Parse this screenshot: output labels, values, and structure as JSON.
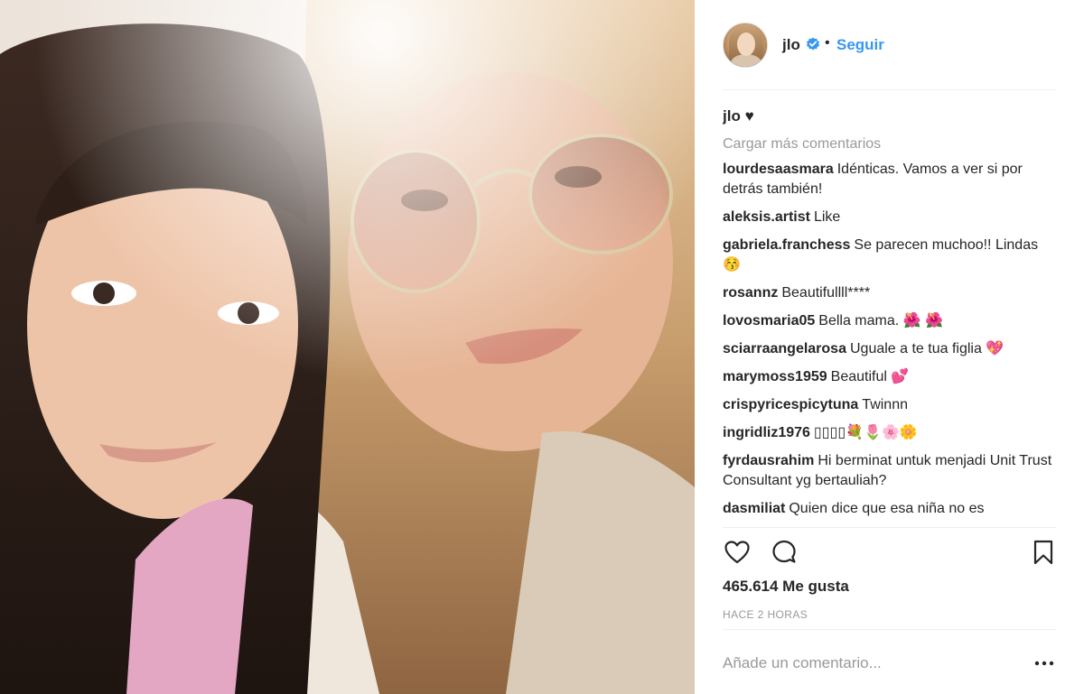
{
  "post": {
    "username": "jlo",
    "separator": "•",
    "follow_label": "Seguir",
    "caption_user": "jlo",
    "caption_text": "♥",
    "load_more": "Cargar más comentarios",
    "comments": [
      {
        "user": "lourdesaasmara",
        "text": "Idénticas. Vamos a ver si por detrás también!"
      },
      {
        "user": "aleksis.artist",
        "text": "Like"
      },
      {
        "user": "gabriela.franchess",
        "text": "Se parecen muchoo!! Lindas 😚"
      },
      {
        "user": "rosannz",
        "text": "Beautifullll****"
      },
      {
        "user": "lovosmaria05",
        "text": "Bella mama. 🌺 🌺"
      },
      {
        "user": "sciarraangelarosa",
        "text": "Uguale a te tua figlia 💖"
      },
      {
        "user": "marymoss1959",
        "text": "Beautiful 💕"
      },
      {
        "user": "crispyricespicytuna",
        "text": "Twinnn"
      },
      {
        "user": "ingridliz1976",
        "text": "▯▯▯▯💐🌷🌸🌼"
      },
      {
        "user": "fyrdausrahim",
        "text": "Hi berminat untuk menjadi Unit Trust Consultant yg bertauliah?"
      },
      {
        "user": "dasmiliat",
        "text": "Quien dice que esa niña no es"
      }
    ],
    "likes": "465.614 Me gusta",
    "time": "HACE 2 HORAS",
    "add_comment_placeholder": "Añade un comentario...",
    "icons": {
      "like": "heart-icon",
      "comment": "comment-bubble-icon",
      "save": "bookmark-icon",
      "more": "more-options-icon",
      "verified": "verified-badge-icon"
    },
    "colors": {
      "link": "#3897f0",
      "verified": "#3897f0",
      "muted": "#999999",
      "text": "#262626",
      "divider": "#efefef"
    }
  }
}
